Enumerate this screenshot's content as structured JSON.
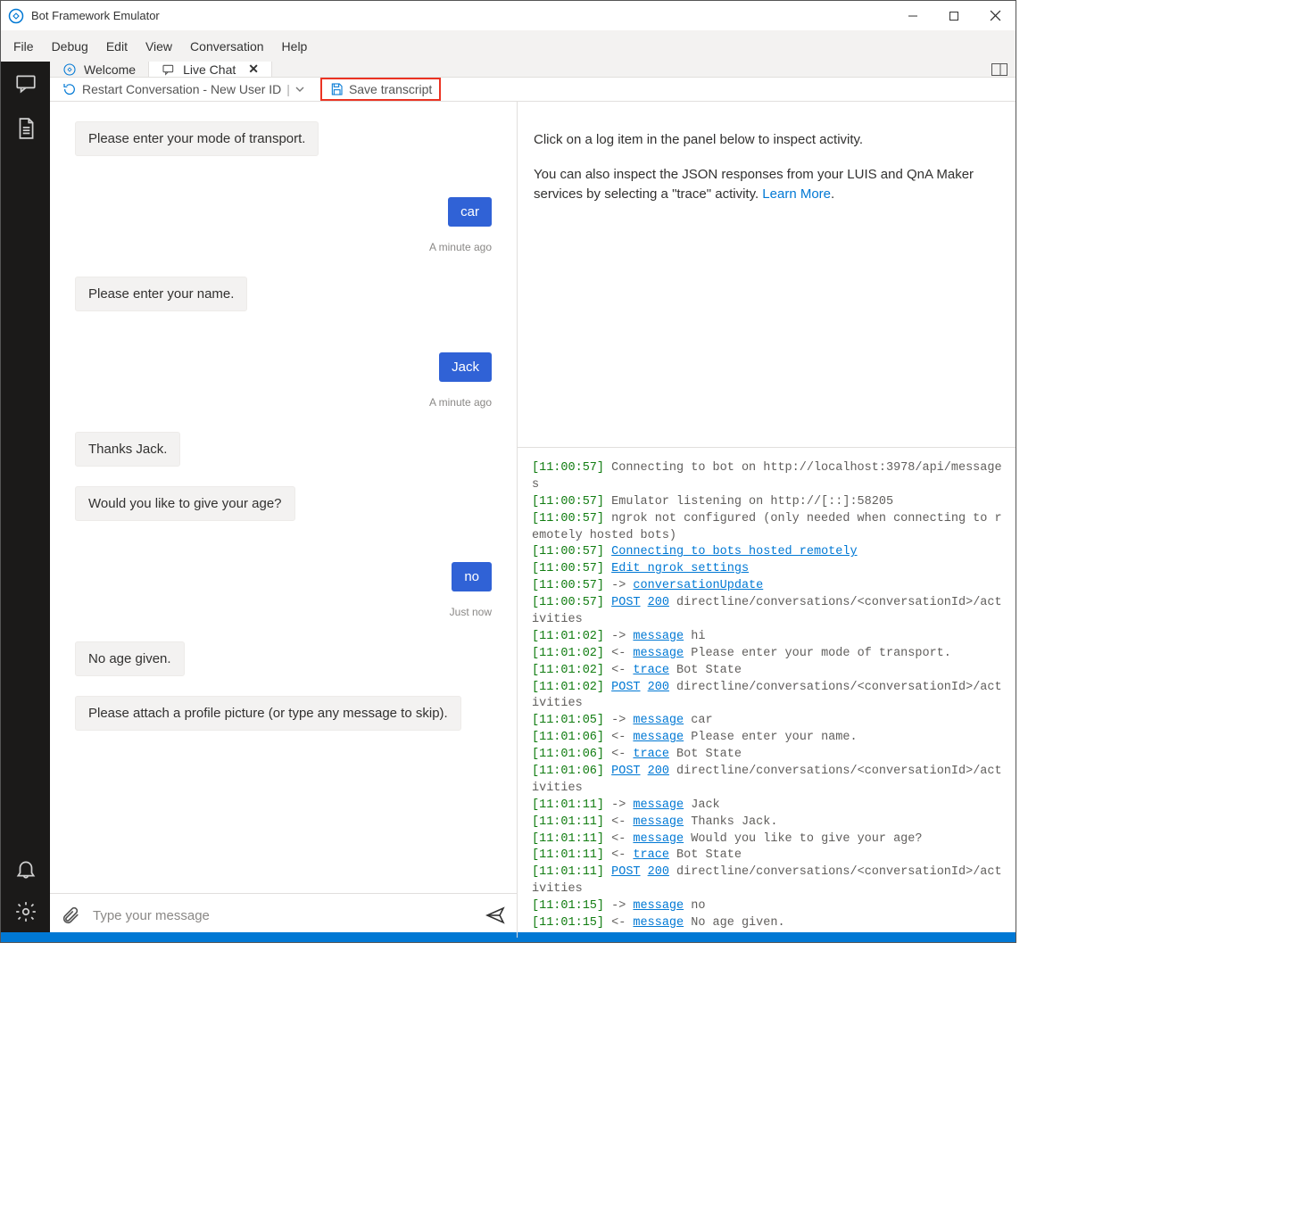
{
  "titlebar": {
    "app_title": "Bot Framework Emulator"
  },
  "menubar": [
    "File",
    "Debug",
    "Edit",
    "View",
    "Conversation",
    "Help"
  ],
  "tabs": {
    "welcome": "Welcome",
    "livechat": "Live Chat"
  },
  "toolbar": {
    "restart_label": "Restart Conversation - New User ID",
    "save_transcript_label": "Save transcript"
  },
  "chat": {
    "messages": [
      {
        "side": "bot",
        "text": "Please enter your mode of transport."
      },
      {
        "side": "user",
        "text": "car",
        "time": "A minute ago"
      },
      {
        "side": "bot",
        "text": "Please enter your name."
      },
      {
        "side": "user",
        "text": "Jack",
        "time": "A minute ago"
      },
      {
        "side": "bot",
        "text": "Thanks Jack."
      },
      {
        "side": "bot",
        "text": "Would you like to give your age?"
      },
      {
        "side": "user",
        "text": "no",
        "time": "Just now"
      },
      {
        "side": "bot",
        "text": "No age given."
      },
      {
        "side": "bot",
        "text": "Please attach a profile picture (or type any message to skip)."
      }
    ],
    "composer_placeholder": "Type your message"
  },
  "inspector": {
    "line1": "Click on a log item in the panel below to inspect activity.",
    "line2a": "You can also inspect the JSON responses from your LUIS and QnA Maker services by selecting a \"trace\" activity. ",
    "learn_more": "Learn More"
  },
  "log": [
    {
      "t": "[11:00:57]",
      "parts": [
        {
          "k": "plain",
          "v": " Connecting to bot on http://localhost:3978/api/messages"
        }
      ]
    },
    {
      "t": "[11:00:57]",
      "parts": [
        {
          "k": "plain",
          "v": " Emulator listening on http://[::]:58205"
        }
      ]
    },
    {
      "t": "[11:00:57]",
      "parts": [
        {
          "k": "plain",
          "v": " ngrok not configured (only needed when connecting to remotely hosted bots)"
        }
      ]
    },
    {
      "t": "[11:00:57]",
      "parts": [
        {
          "k": "plain",
          "v": " "
        },
        {
          "k": "lnk",
          "v": "Connecting to bots hosted remotely"
        }
      ]
    },
    {
      "t": "[11:00:57]",
      "parts": [
        {
          "k": "plain",
          "v": " "
        },
        {
          "k": "lnk",
          "v": "Edit ngrok settings"
        }
      ]
    },
    {
      "t": "[11:00:57]",
      "parts": [
        {
          "k": "arr",
          "v": " -> "
        },
        {
          "k": "lnk",
          "v": "conversationUpdate"
        }
      ]
    },
    {
      "t": "[11:00:57]",
      "parts": [
        {
          "k": "plain",
          "v": " "
        },
        {
          "k": "lnk",
          "v": "POST"
        },
        {
          "k": "plain",
          "v": " "
        },
        {
          "k": "lnk",
          "v": "200"
        },
        {
          "k": "plain",
          "v": " directline/conversations/<conversationId>/activities"
        }
      ]
    },
    {
      "t": "[11:01:02]",
      "parts": [
        {
          "k": "arr",
          "v": " -> "
        },
        {
          "k": "lnk",
          "v": "message"
        },
        {
          "k": "plain",
          "v": " hi"
        }
      ]
    },
    {
      "t": "[11:01:02]",
      "parts": [
        {
          "k": "arr",
          "v": " <- "
        },
        {
          "k": "lnk",
          "v": "message"
        },
        {
          "k": "plain",
          "v": " Please enter your mode of transport."
        }
      ]
    },
    {
      "t": "[11:01:02]",
      "parts": [
        {
          "k": "arr",
          "v": " <- "
        },
        {
          "k": "lnk",
          "v": "trace"
        },
        {
          "k": "plain",
          "v": " Bot State"
        }
      ]
    },
    {
      "t": "[11:01:02]",
      "parts": [
        {
          "k": "plain",
          "v": " "
        },
        {
          "k": "lnk",
          "v": "POST"
        },
        {
          "k": "plain",
          "v": " "
        },
        {
          "k": "lnk",
          "v": "200"
        },
        {
          "k": "plain",
          "v": " directline/conversations/<conversationId>/activities"
        }
      ]
    },
    {
      "t": "[11:01:05]",
      "parts": [
        {
          "k": "arr",
          "v": " -> "
        },
        {
          "k": "lnk",
          "v": "message"
        },
        {
          "k": "plain",
          "v": " car"
        }
      ]
    },
    {
      "t": "[11:01:06]",
      "parts": [
        {
          "k": "arr",
          "v": " <- "
        },
        {
          "k": "lnk",
          "v": "message"
        },
        {
          "k": "plain",
          "v": " Please enter your name."
        }
      ]
    },
    {
      "t": "[11:01:06]",
      "parts": [
        {
          "k": "arr",
          "v": " <- "
        },
        {
          "k": "lnk",
          "v": "trace"
        },
        {
          "k": "plain",
          "v": " Bot State"
        }
      ]
    },
    {
      "t": "[11:01:06]",
      "parts": [
        {
          "k": "plain",
          "v": " "
        },
        {
          "k": "lnk",
          "v": "POST"
        },
        {
          "k": "plain",
          "v": " "
        },
        {
          "k": "lnk",
          "v": "200"
        },
        {
          "k": "plain",
          "v": " directline/conversations/<conversationId>/activities"
        }
      ]
    },
    {
      "t": "[11:01:11]",
      "parts": [
        {
          "k": "arr",
          "v": " -> "
        },
        {
          "k": "lnk",
          "v": "message"
        },
        {
          "k": "plain",
          "v": " Jack"
        }
      ]
    },
    {
      "t": "[11:01:11]",
      "parts": [
        {
          "k": "arr",
          "v": " <- "
        },
        {
          "k": "lnk",
          "v": "message"
        },
        {
          "k": "plain",
          "v": " Thanks Jack."
        }
      ]
    },
    {
      "t": "[11:01:11]",
      "parts": [
        {
          "k": "arr",
          "v": " <- "
        },
        {
          "k": "lnk",
          "v": "message"
        },
        {
          "k": "plain",
          "v": " Would you like to give your age?"
        }
      ]
    },
    {
      "t": "[11:01:11]",
      "parts": [
        {
          "k": "arr",
          "v": " <- "
        },
        {
          "k": "lnk",
          "v": "trace"
        },
        {
          "k": "plain",
          "v": " Bot State"
        }
      ]
    },
    {
      "t": "[11:01:11]",
      "parts": [
        {
          "k": "plain",
          "v": " "
        },
        {
          "k": "lnk",
          "v": "POST"
        },
        {
          "k": "plain",
          "v": " "
        },
        {
          "k": "lnk",
          "v": "200"
        },
        {
          "k": "plain",
          "v": " directline/conversations/<conversationId>/activities"
        }
      ]
    },
    {
      "t": "[11:01:15]",
      "parts": [
        {
          "k": "arr",
          "v": " -> "
        },
        {
          "k": "lnk",
          "v": "message"
        },
        {
          "k": "plain",
          "v": " no"
        }
      ]
    },
    {
      "t": "[11:01:15]",
      "parts": [
        {
          "k": "arr",
          "v": " <- "
        },
        {
          "k": "lnk",
          "v": "message"
        },
        {
          "k": "plain",
          "v": " No age given."
        }
      ]
    }
  ]
}
